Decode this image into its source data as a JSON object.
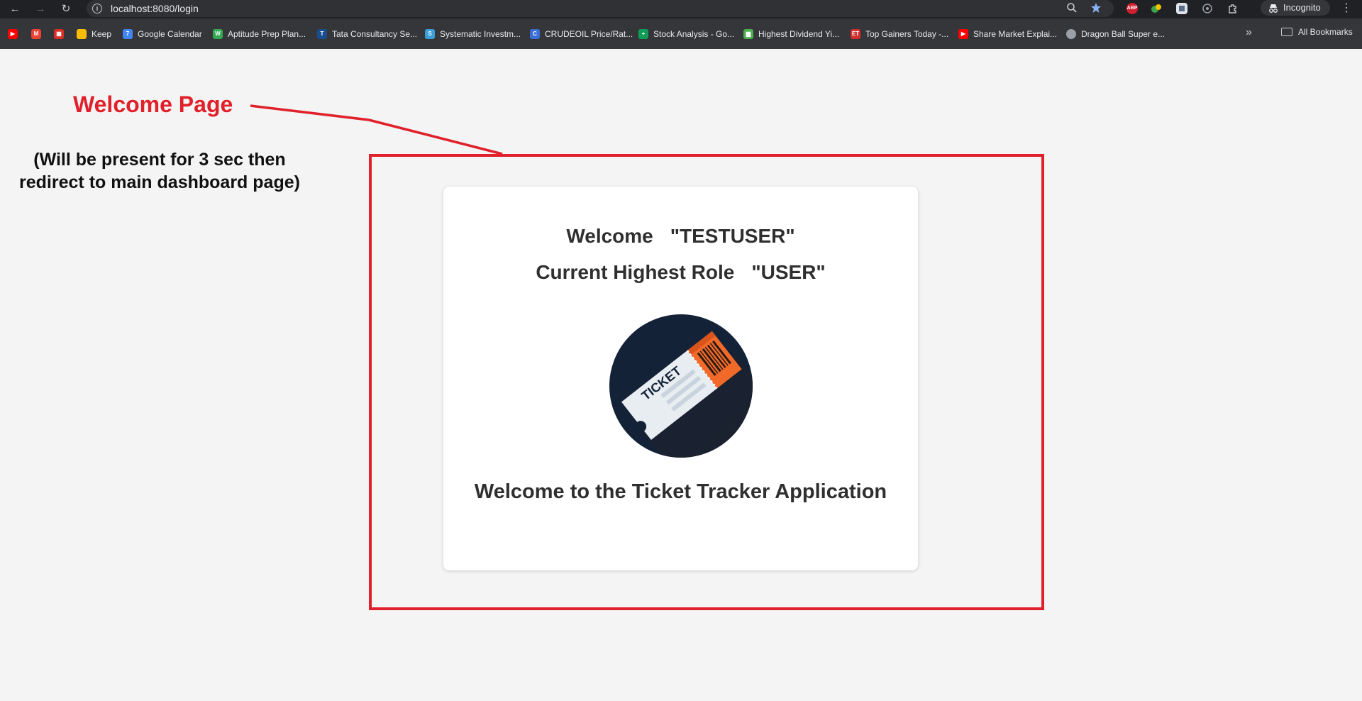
{
  "browser": {
    "url": "localhost:8080/login",
    "incognito_label": "Incognito",
    "extensions": [
      "ABP"
    ],
    "bookmarks": [
      {
        "label": "",
        "icon": "youtube-icon",
        "color": "#ff0000"
      },
      {
        "label": "",
        "icon": "gmail-icon",
        "color": "#ea4335"
      },
      {
        "label": "",
        "icon": "calendar-app-icon",
        "color": "#d93025"
      },
      {
        "label": "Keep",
        "icon": "keep-icon",
        "color": "#fbbc04"
      },
      {
        "label": "Google Calendar",
        "icon": "google-calendar-icon",
        "color": "#4285f4"
      },
      {
        "label": "Aptitude Prep Plan...",
        "icon": "aptitude-icon",
        "color": "#34a853"
      },
      {
        "label": "Tata Consultancy Se...",
        "icon": "tcs-icon",
        "color": "#1a4d8f"
      },
      {
        "label": "Systematic Investm...",
        "icon": "sip-icon",
        "color": "#3b9fd8"
      },
      {
        "label": "CRUDEOIL Price/Rat...",
        "icon": "crudeoil-icon",
        "color": "#3a6fd8"
      },
      {
        "label": "Stock Analysis - Go...",
        "icon": "sheets-icon",
        "color": "#0f9d58"
      },
      {
        "label": "Highest Dividend Yi...",
        "icon": "bar-chart-icon",
        "color": "#4caf50"
      },
      {
        "label": "Top Gainers Today -...",
        "icon": "et-icon",
        "color": "#d32f2f"
      },
      {
        "label": "Share Market Explai...",
        "icon": "youtube-icon",
        "color": "#ff0000"
      },
      {
        "label": "Dragon Ball Super e...",
        "icon": "globe-icon",
        "color": "#9aa0a6"
      }
    ],
    "all_bookmarks_label": "All Bookmarks"
  },
  "annotation": {
    "title": "Welcome Page",
    "note_line1": "(Will be present for 3 sec then",
    "note_line2": "redirect to main dashboard page)",
    "color": "#e0202a"
  },
  "card": {
    "welcome_label": "Welcome",
    "username": "\"TESTUSER\"",
    "role_label": "Current Highest Role",
    "role_value": "\"USER\"",
    "logo_text": "TICKET",
    "footer": "Welcome to the Ticket Tracker Application"
  }
}
